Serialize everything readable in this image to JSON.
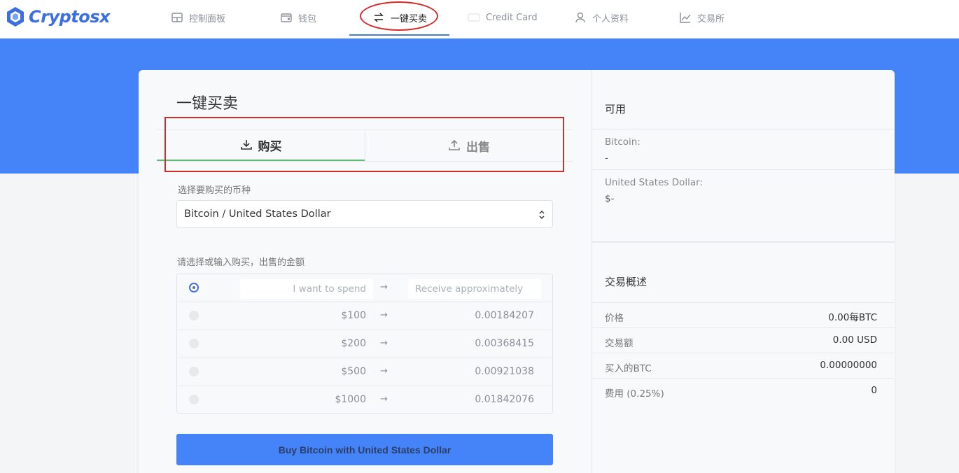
{
  "brand": {
    "name": "Cryptosx",
    "accent": "#3b6fe0"
  },
  "nav": {
    "items": [
      {
        "label": "控制面板",
        "icon": "dashboard-icon"
      },
      {
        "label": "钱包",
        "icon": "wallet-icon"
      },
      {
        "label": "一键买卖",
        "icon": "swap-arrows-icon",
        "active": true
      },
      {
        "label": "Credit Card",
        "icon": "credit-card-icon"
      },
      {
        "label": "个人资料",
        "icon": "user-icon"
      },
      {
        "label": "交易所",
        "icon": "chart-line-icon"
      }
    ]
  },
  "main": {
    "title": "一键买卖",
    "tabs": [
      {
        "label": "购买",
        "icon": "download-icon",
        "active": true
      },
      {
        "label": "出售",
        "icon": "upload-icon"
      }
    ],
    "currency_label": "选择要购买的币种",
    "currency_selected": "Bitcoin / United States Dollar",
    "amount_label": "请选择或输入购买，出售的金额",
    "spend_placeholder": "I want to spend",
    "receive_placeholder": "Receive approximately",
    "arrow": "→",
    "presets": [
      {
        "spend": "$100",
        "receive": "0.00184207"
      },
      {
        "spend": "$200",
        "receive": "0.00368415"
      },
      {
        "spend": "$500",
        "receive": "0.00921038"
      },
      {
        "spend": "$1000",
        "receive": "0.01842076"
      }
    ],
    "buy_button": "Buy Bitcoin with United States Dollar"
  },
  "balance": {
    "title": "可用",
    "bitcoin_label": "Bitcoin:",
    "bitcoin_value": "-",
    "usd_label": "United States Dollar:",
    "usd_value": "$-"
  },
  "summary": {
    "title": "交易概述",
    "rows": [
      {
        "label": "价格",
        "value": "0.00每BTC"
      },
      {
        "label": "交易额",
        "value": "0.00 USD"
      },
      {
        "label": "买入的BTC",
        "value": "0.00000000"
      },
      {
        "label": "费用 (0.25%)",
        "value": "0"
      }
    ]
  },
  "colors": {
    "banner": "#4584f8",
    "annotation": "#d42a2a",
    "tab_active_underline": "#5fbf7a"
  }
}
